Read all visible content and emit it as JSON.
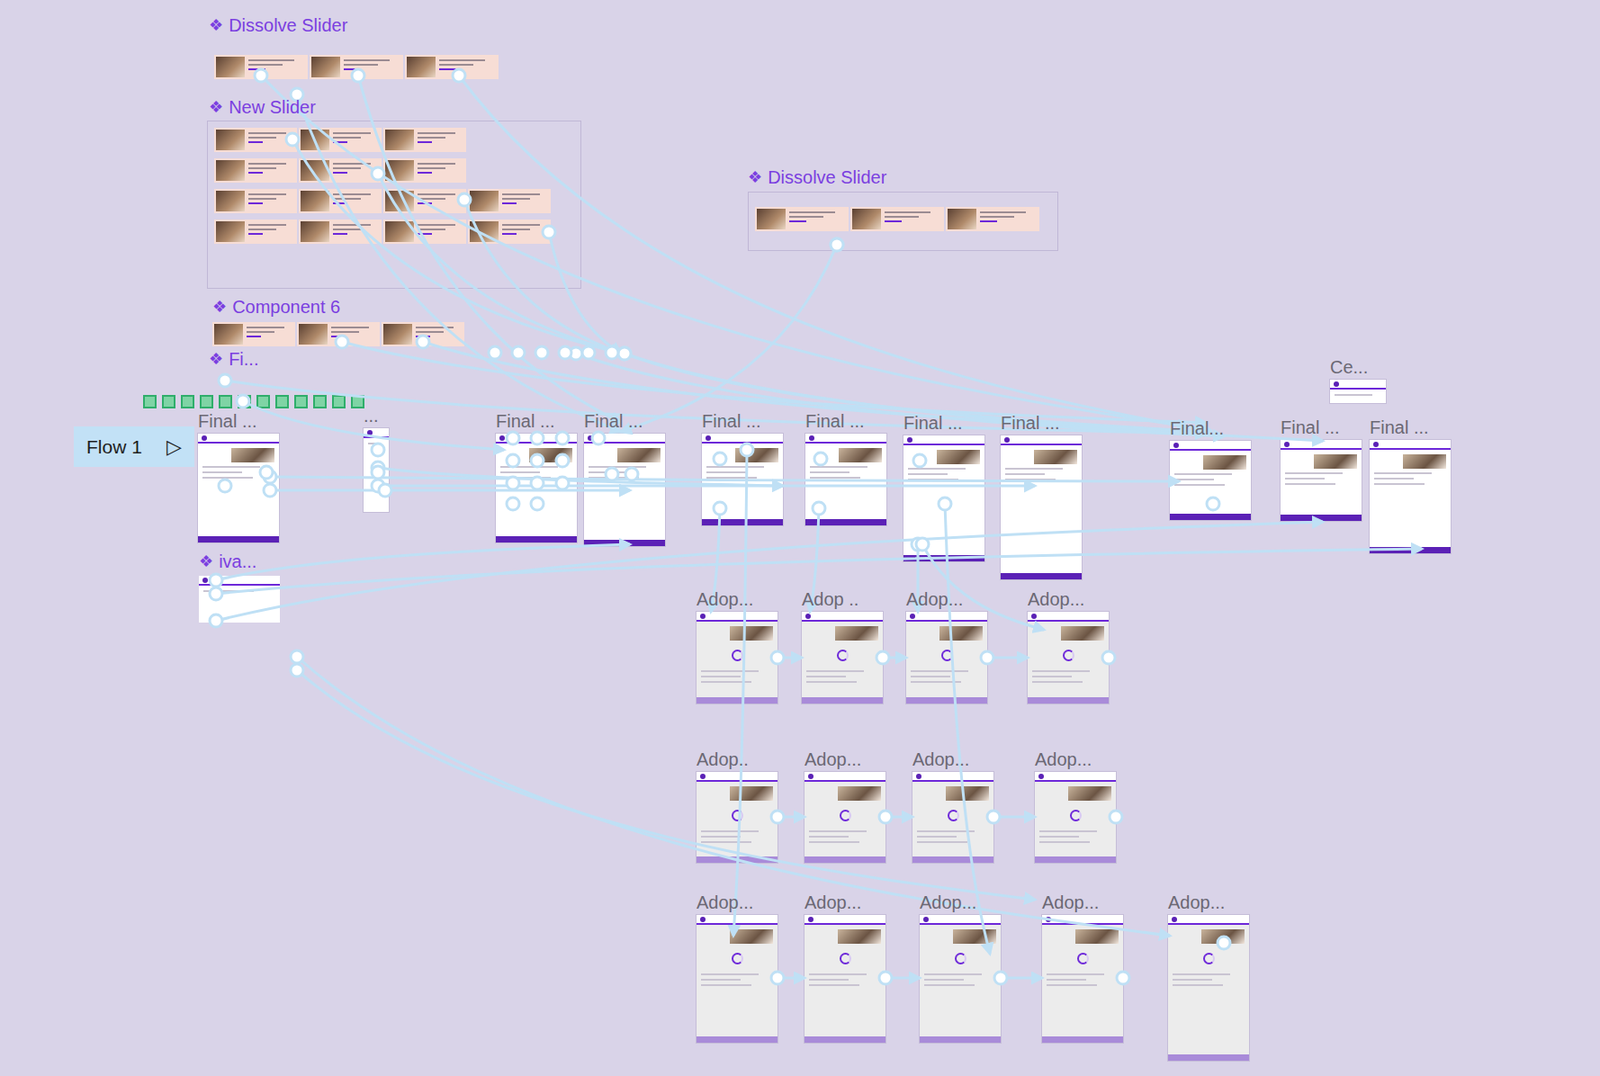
{
  "flow": {
    "label": "Flow 1",
    "icon": "▷"
  },
  "components": [
    {
      "icon": "❖",
      "name": "Dissolve Slider",
      "kind": "slider"
    },
    {
      "icon": "❖",
      "name": "New Slider",
      "kind": "slider"
    },
    {
      "icon": "❖",
      "name": "Dissolve Slider",
      "kind": "slider"
    },
    {
      "icon": "❖",
      "name": "Component 6",
      "kind": "slider"
    },
    {
      "icon": "❖",
      "name": "Fi...",
      "kind": "strip"
    },
    {
      "icon": "❖",
      "name": "iva...",
      "kind": "frame"
    }
  ],
  "frames": [
    {
      "name": "Final ..."
    },
    {
      "name": "..."
    },
    {
      "name": "Final ..."
    },
    {
      "name": "Final ..."
    },
    {
      "name": "Final ..."
    },
    {
      "name": "Final ..."
    },
    {
      "name": "Final ..."
    },
    {
      "name": "Final ..."
    },
    {
      "name": "Final..."
    },
    {
      "name": "Final ..."
    },
    {
      "name": "Final ..."
    },
    {
      "name": "Ce..."
    }
  ],
  "adoption_rows": [
    [
      {
        "name": "Adop..."
      },
      {
        "name": "Adop .."
      },
      {
        "name": "Adop..."
      },
      {
        "name": "Adop..."
      }
    ],
    [
      {
        "name": "Adop.."
      },
      {
        "name": "Adop..."
      },
      {
        "name": "Adop..."
      },
      {
        "name": "Adop..."
      }
    ],
    [
      {
        "name": "Adop..."
      },
      {
        "name": "Adop..."
      },
      {
        "name": "Adop..."
      },
      {
        "name": "Adop..."
      },
      {
        "name": "Adop..."
      }
    ]
  ]
}
